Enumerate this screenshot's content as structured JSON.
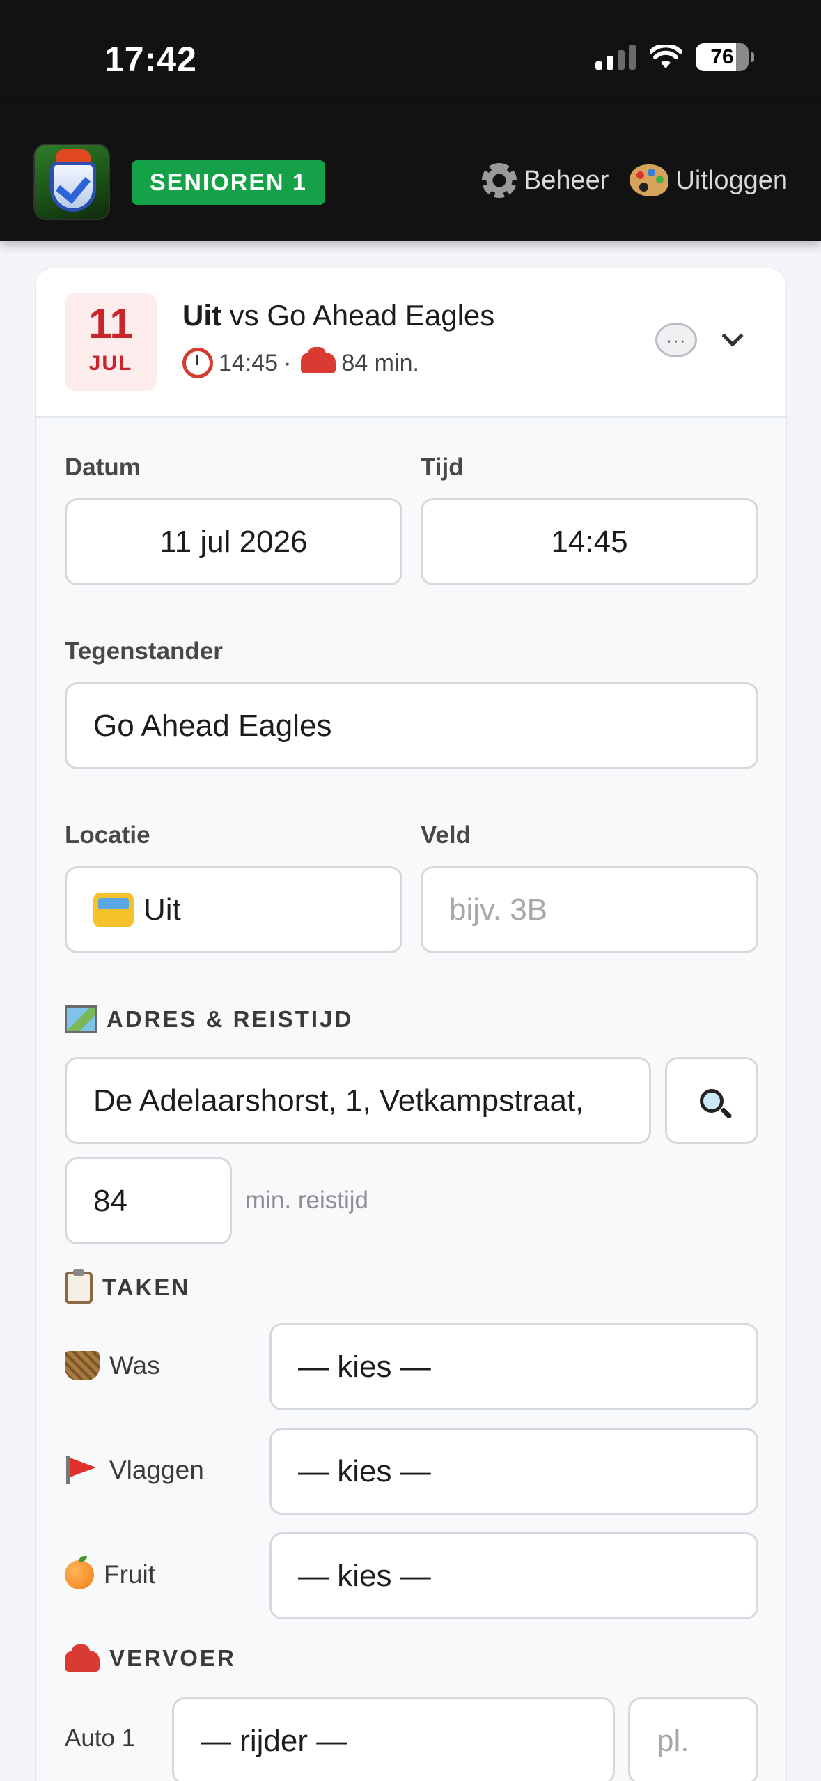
{
  "status_bar": {
    "time": "17:42",
    "battery": "76"
  },
  "header": {
    "team_badge": "SENIOREN 1",
    "nav": [
      {
        "label": "Beheer",
        "icon": "gear-icon"
      },
      {
        "label": "Uitloggen",
        "icon": "palette-icon"
      }
    ]
  },
  "match": {
    "day": "11",
    "month": "JUL",
    "title_prefix": "Uit",
    "title_rest": " vs Go Ahead Eagles",
    "time": "14:45",
    "separator": "·",
    "travel": "84 min."
  },
  "form": {
    "datum_label": "Datum",
    "datum_value": "11 jul 2026",
    "tijd_label": "Tijd",
    "tijd_value": "14:45",
    "tegenstander_label": "Tegenstander",
    "tegenstander_value": "Go Ahead Eagles",
    "locatie_label": "Locatie",
    "locatie_value": "Uit",
    "veld_label": "Veld",
    "veld_placeholder": "bijv. 3B"
  },
  "adres": {
    "title": "ADRES & REISTIJD",
    "address_value": "De Adelaarshorst, 1, Vetkampstraat,",
    "travel_minutes": "84",
    "travel_hint": "min. reistijd"
  },
  "taken": {
    "title": "TAKEN",
    "items": [
      {
        "label": "Was",
        "value": "— kies —",
        "icon": "basket-icon"
      },
      {
        "label": "Vlaggen",
        "value": "— kies —",
        "icon": "flag-icon"
      },
      {
        "label": "Fruit",
        "value": "— kies —",
        "icon": "orange-icon"
      }
    ]
  },
  "vervoer": {
    "title": "VERVOER",
    "rows": [
      {
        "label": "Auto 1",
        "driver": "— rijder —",
        "seats_placeholder": "pl."
      }
    ]
  },
  "colors": {
    "accent_green": "#15a148",
    "date_red": "#c8262c",
    "header_bg": "#121212"
  }
}
